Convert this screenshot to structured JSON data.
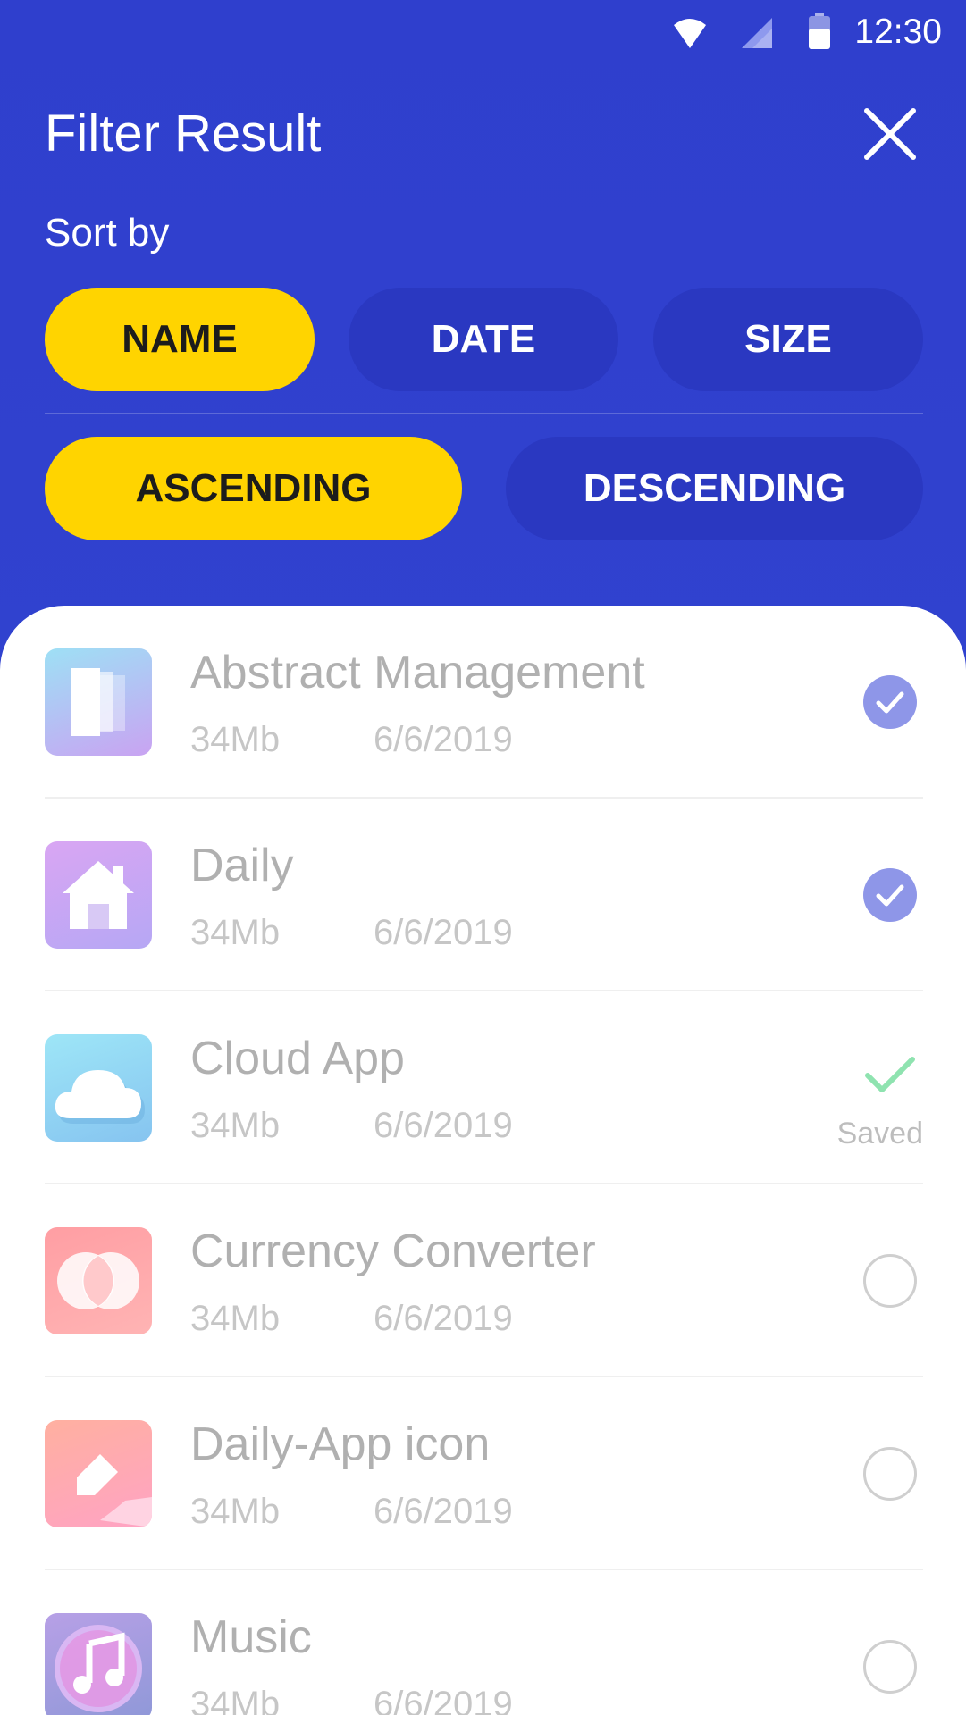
{
  "status_bar": {
    "time": "12:30"
  },
  "header": {
    "title": "Filter Result",
    "sort_label": "Sort by",
    "sort_options": [
      {
        "label": "NAME",
        "selected": true
      },
      {
        "label": "DATE",
        "selected": false
      },
      {
        "label": "SIZE",
        "selected": false
      }
    ],
    "order_options": [
      {
        "label": "ASCENDING",
        "selected": true
      },
      {
        "label": "DESCENDING",
        "selected": false
      }
    ]
  },
  "items": [
    {
      "name": "Abstract Management",
      "size": "34Mb",
      "date": "6/6/2019",
      "state": "checked",
      "icon": "abstract-management-icon"
    },
    {
      "name": "Daily",
      "size": "34Mb",
      "date": "6/6/2019",
      "state": "checked",
      "icon": "home-icon"
    },
    {
      "name": "Cloud App",
      "size": "34Mb",
      "date": "6/6/2019",
      "state": "saved",
      "saved_label": "Saved",
      "icon": "cloud-icon"
    },
    {
      "name": "Currency Converter",
      "size": "34Mb",
      "date": "6/6/2019",
      "state": "unchecked",
      "icon": "currency-converter-icon"
    },
    {
      "name": "Daily-App icon",
      "size": "34Mb",
      "date": "6/6/2019",
      "state": "unchecked",
      "icon": "eraser-icon"
    },
    {
      "name": "Music",
      "size": "34Mb",
      "date": "6/6/2019",
      "state": "unchecked",
      "icon": "music-note-icon"
    }
  ],
  "colors": {
    "header_bg": "#3041cc",
    "accent_yellow": "#ffd400",
    "check_purple": "#8e96e8",
    "saved_green": "#8fe3b0"
  }
}
